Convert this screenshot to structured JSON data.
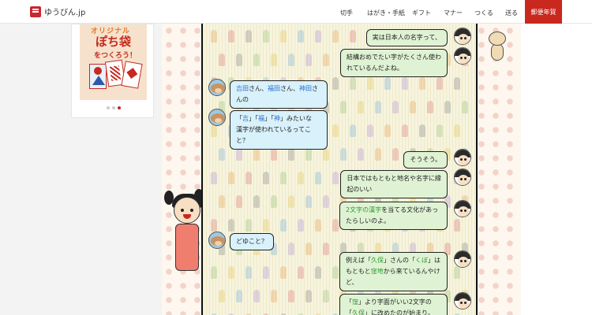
{
  "header": {
    "logo_text": "ゆうびん.jp",
    "nav": [
      "切手",
      "はがき・手紙",
      "ギフト",
      "マナー",
      "つくる",
      "送る"
    ],
    "cta_label": "郵便年賀"
  },
  "promo": {
    "line1": "オリジナル",
    "line2": "ぽち袋",
    "line3": "をつくろう！",
    "carousel_dots": 3,
    "active_dot": 3
  },
  "chat": {
    "messages": [
      {
        "side": "right",
        "avatar": "boy-avatar",
        "lines": [
          "実は日本人の名字って、"
        ]
      },
      {
        "side": "right",
        "avatar": "boy-avatar",
        "lines": [
          "結構おめでたい字がたくさん使わ",
          "れているんだよね。"
        ]
      },
      {
        "side": "left",
        "avatar": "dog-avatar",
        "parts": [
          [
            "吉田",
            "b"
          ],
          [
            "さん、",
            ""
          ],
          [
            "福田",
            "b"
          ],
          [
            "さん、",
            ""
          ],
          [
            "神田",
            "b"
          ],
          [
            "さ\nんの",
            ""
          ]
        ]
      },
      {
        "side": "left",
        "avatar": "dog-avatar",
        "parts": [
          [
            "「",
            ""
          ],
          [
            "吉",
            "b"
          ],
          [
            "」「",
            ""
          ],
          [
            "福",
            "b"
          ],
          [
            "」「",
            ""
          ],
          [
            "神",
            "b"
          ],
          [
            "」みたいな\n漢字が使われているってこ\nと？",
            ""
          ]
        ]
      },
      {
        "side": "right",
        "avatar": "boy-avatar",
        "lines": [
          "そうそう。"
        ]
      },
      {
        "side": "right",
        "avatar": "boy-avatar",
        "lines": [
          "日本ではもともと地名や名字に縁",
          "起のいい"
        ]
      },
      {
        "side": "right",
        "avatar": "boy-avatar",
        "parts": [
          [
            "2文字の漢字",
            "g"
          ],
          [
            "を当てる文化があっ\nたらしいのよ。",
            ""
          ]
        ]
      },
      {
        "side": "left",
        "avatar": "dog-avatar",
        "lines": [
          "どゆこと？"
        ]
      },
      {
        "side": "right",
        "avatar": "boy-avatar",
        "parts": [
          [
            "例えば「",
            ""
          ],
          [
            "久保",
            "g"
          ],
          [
            "」さんの「",
            ""
          ],
          [
            "くぼ",
            "g"
          ],
          [
            "」は\nもともと",
            ""
          ],
          [
            "窪地",
            "g"
          ],
          [
            "から来ているんやけ\nど、",
            ""
          ]
        ]
      },
      {
        "side": "right",
        "avatar": "boy-avatar",
        "parts": [
          [
            "「",
            ""
          ],
          [
            "窪",
            "g"
          ],
          [
            "」より字面がいい2文字の\n「",
            ""
          ],
          [
            "久保",
            "g"
          ],
          [
            "」に改めたのが始まり。",
            ""
          ]
        ]
      }
    ]
  },
  "colors": {
    "brand_red": "#c8281e",
    "bubble_green": "#dff3d4",
    "bubble_blue": "#d8f1fb",
    "highlight_blue": "#2a6fcf",
    "highlight_green": "#2f9a2f"
  }
}
